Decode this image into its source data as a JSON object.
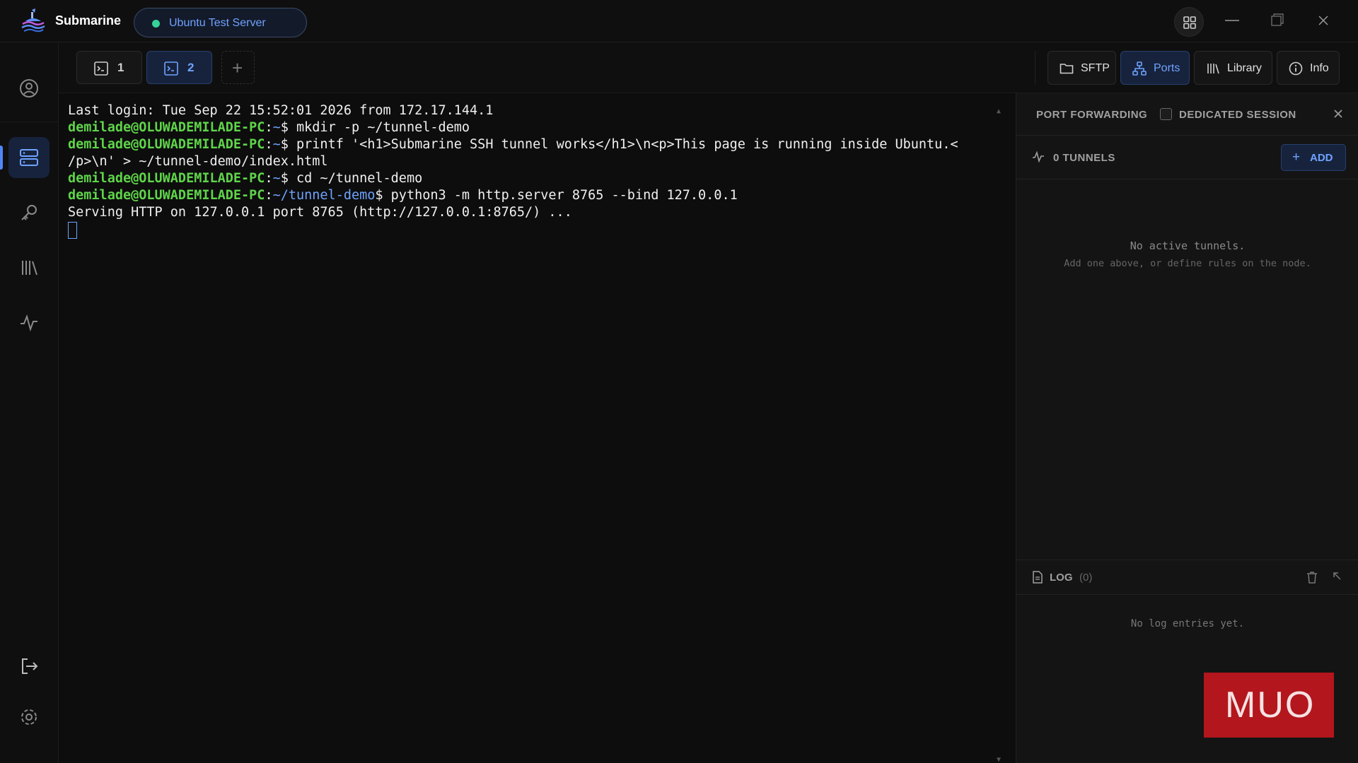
{
  "app": {
    "name": "Submarine"
  },
  "server": {
    "name": "Ubuntu Test Server",
    "status_color": "#34d399"
  },
  "tabs": [
    {
      "label": "1",
      "active": false
    },
    {
      "label": "2",
      "active": true
    }
  ],
  "toolbar": {
    "sftp": "SFTP",
    "ports": "Ports",
    "library": "Library",
    "info": "Info"
  },
  "rail": {
    "items": [
      "user-icon",
      "servers-icon",
      "key-icon",
      "library-icon",
      "activity-icon"
    ],
    "bottom": [
      "logout-icon",
      "settings-icon"
    ]
  },
  "terminal": {
    "line1": "Last login: Tue Sep 22 15:52:01 2026 from 172.17.144.1",
    "user": "demilade@OLUWADEMILADE-PC",
    "home_path": "~",
    "demo_path": "~/tunnel-demo",
    "prompt_char": "$",
    "cmd1": " mkdir -p ~/tunnel-demo",
    "cmd2": " printf '<h1>Submarine SSH tunnel works</h1>\\n<p>This page is running inside Ubuntu.<",
    "cmd2_cont": "/p>\\n' > ~/tunnel-demo/index.html",
    "cmd3": " cd ~/tunnel-demo",
    "cmd4": " python3 -m http.server 8765 --bind 127.0.0.1",
    "output": "Serving HTTP on 127.0.0.1 port 8765 (http://127.0.0.1:8765/) ..."
  },
  "panel": {
    "title": "PORT FORWARDING",
    "dedicated": "DEDICATED SESSION",
    "tunnels": "0 TUNNELS",
    "add": "ADD",
    "empty_title": "No active tunnels.",
    "empty_sub": "Add one above, or define rules on the node.",
    "log_title": "LOG",
    "log_count": "(0)",
    "log_empty": "No log entries yet."
  },
  "watermark": {
    "text": "MUO"
  },
  "colors": {
    "accent": "#4f86f7",
    "prompt_user": "#5fd44a",
    "prompt_path": "#6fa3ff",
    "watermark": "#b3161d"
  }
}
